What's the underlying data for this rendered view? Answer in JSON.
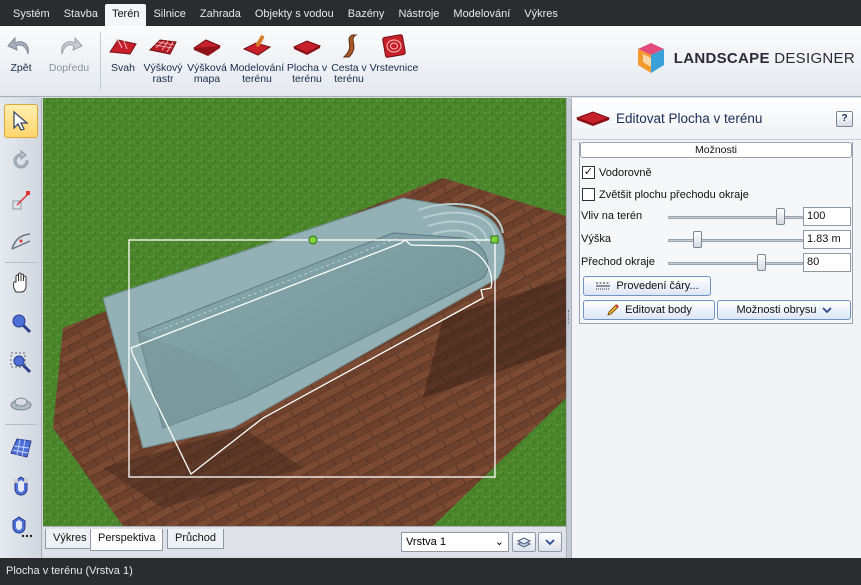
{
  "menu": {
    "items": [
      "Systém",
      "Stavba",
      "Terén",
      "Silnice",
      "Zahrada",
      "Objekty s vodou",
      "Bazény",
      "Nástroje",
      "Modelování",
      "Výkres"
    ],
    "active_index": 2
  },
  "ribbon": {
    "undo_label": "Zpět",
    "redo_label": "Dopředu",
    "tools": [
      {
        "line1": "Svah",
        "line2": ""
      },
      {
        "line1": "Výškový",
        "line2": "rastr"
      },
      {
        "line1": "Výšková",
        "line2": "mapa"
      },
      {
        "line1": "Modelování",
        "line2": "terénu"
      },
      {
        "line1": "Plocha v",
        "line2": "terénu"
      },
      {
        "line1": "Cesta v",
        "line2": "terénu"
      },
      {
        "line1": "Vrstevnice",
        "line2": ""
      }
    ],
    "logo_word1": "LANDSCAPE",
    "logo_word2": "DESIGNER"
  },
  "viewport_tabs": {
    "tabs": [
      "Výkres",
      "Perspektiva",
      "Průchod"
    ],
    "active_index": 1,
    "layer_value": "Vrstva 1"
  },
  "panel": {
    "title": "Editovat Plocha v terénu",
    "help_label": "?",
    "options_header": "Možnosti",
    "checkbox_horizontal": {
      "label": "Vodorovně",
      "checked": true
    },
    "checkbox_enlarge": {
      "label": "Zvětšit plochu přechodu okraje",
      "checked": false
    },
    "sliders": [
      {
        "label": "Vliv na terén",
        "value": "100",
        "fraction": 0.86
      },
      {
        "label": "Výška",
        "value": "1.83 m",
        "fraction": 0.2
      },
      {
        "label": "Přechod okraje",
        "value": "80",
        "fraction": 0.71
      }
    ],
    "line_button": "Provedení čáry...",
    "edit_points_button": "Editovat body",
    "outline_options_button": "Možnosti obrysu"
  },
  "status": {
    "text": "Plocha v terénu (Vrstva 1)"
  },
  "colors": {
    "accent": "#c8202a",
    "grass": "#4f8a2e",
    "pool": "#7d9ea2"
  }
}
